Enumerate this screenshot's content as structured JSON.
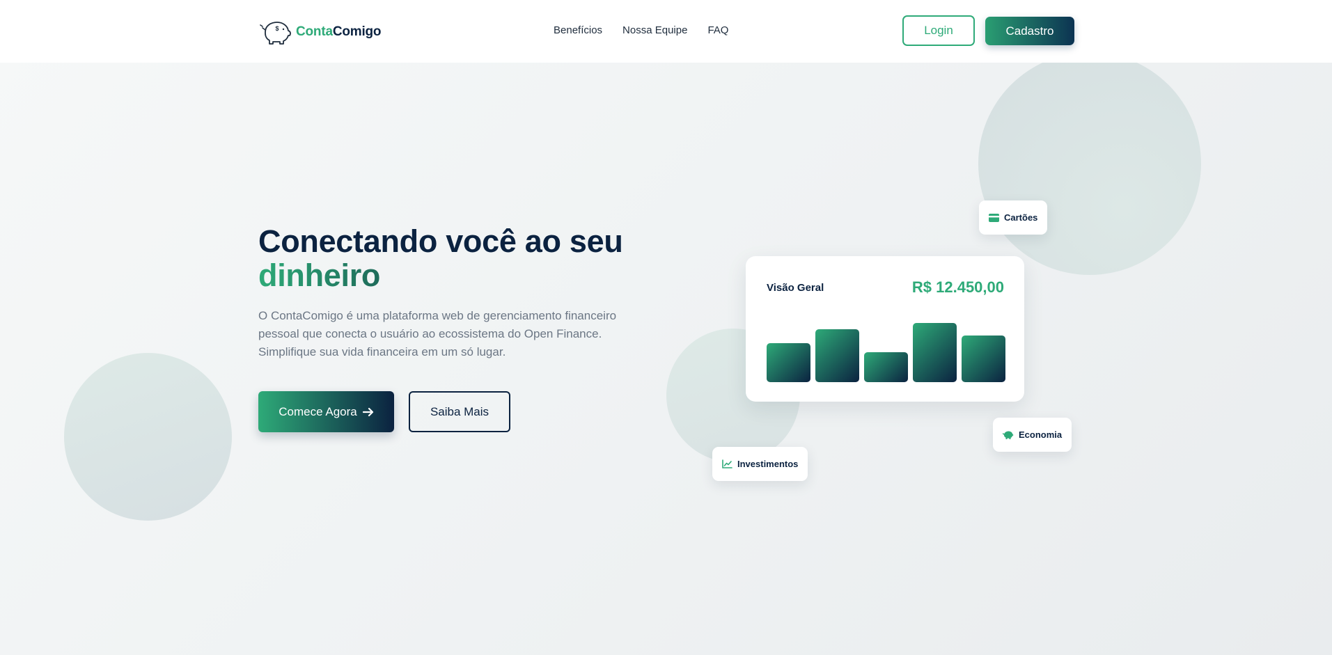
{
  "brand": {
    "name_part1": "Conta",
    "name_part2": "Comigo",
    "logo_icon": "piggy-bank-icon"
  },
  "nav": {
    "items": [
      {
        "label": "Benefícios"
      },
      {
        "label": "Nossa Equipe"
      },
      {
        "label": "FAQ"
      }
    ]
  },
  "auth": {
    "login_label": "Login",
    "signup_label": "Cadastro"
  },
  "hero": {
    "title_line1": "Conectando você ao seu",
    "title_highlight": "dinheiro",
    "description": "O ContaComigo é uma plataforma web de gerenciamento financeiro pessoal que conecta o usuário ao ecossistema do Open Finance. Simplifique sua vida financeira em um só lugar.",
    "primary_cta": "Comece Agora",
    "primary_cta_icon": "arrow-right-icon",
    "secondary_cta": "Saiba Mais"
  },
  "overview_card": {
    "title": "Visão Geral",
    "value": "R$ 12.450,00",
    "bars": [
      0.62,
      0.84,
      0.48,
      0.94,
      0.74
    ]
  },
  "chips": {
    "cartoes": {
      "label": "Cartões",
      "icon": "credit-card-icon"
    },
    "economia": {
      "label": "Economia",
      "icon": "piggy-bank-icon"
    },
    "investimentos": {
      "label": "Investimentos",
      "icon": "line-chart-icon"
    }
  },
  "colors": {
    "primary_green": "#2eaa78",
    "navy": "#0b2240",
    "muted_text": "#6b7684"
  }
}
